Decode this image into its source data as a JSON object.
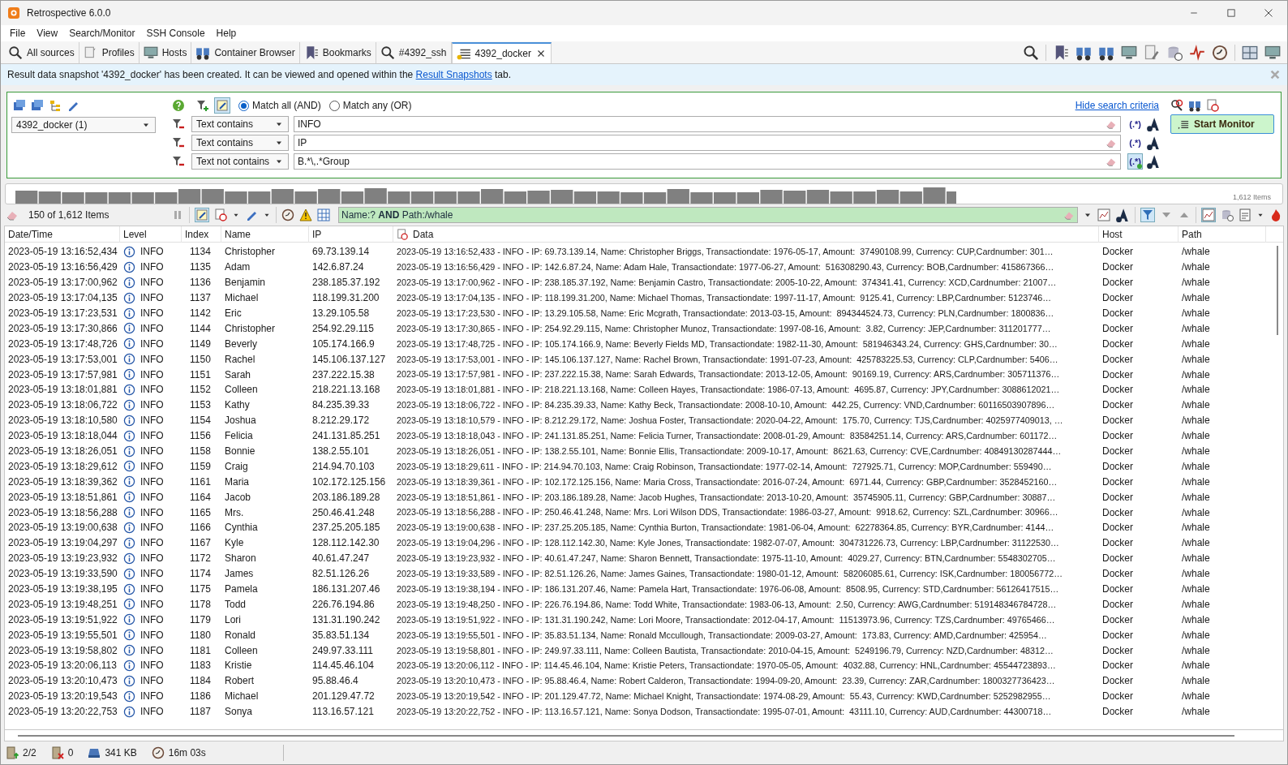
{
  "window": {
    "title": "Retrospective 6.0.0"
  },
  "menu": [
    "File",
    "View",
    "Search/Monitor",
    "SSH Console",
    "Help"
  ],
  "tabs": [
    {
      "label": "All sources",
      "selected": false,
      "closable": false
    },
    {
      "label": "Profiles",
      "selected": false,
      "closable": false
    },
    {
      "label": "Hosts",
      "selected": false,
      "closable": false
    },
    {
      "label": "Container Browser",
      "selected": false,
      "closable": false
    },
    {
      "label": "Bookmarks",
      "selected": false,
      "closable": false
    },
    {
      "label": "#4392_ssh",
      "selected": false,
      "closable": false
    },
    {
      "label": "4392_docker",
      "selected": true,
      "closable": true
    }
  ],
  "notification": {
    "text": "Result data snapshot '4392_docker' has been created. It can be viewed and opened within the",
    "link": "Result Snapshots",
    "text_after": "tab."
  },
  "search": {
    "source": "4392_docker (1)",
    "match_options": [
      {
        "label": "Match all (AND)",
        "selected": true
      },
      {
        "label": "Match any (OR)",
        "selected": false
      }
    ],
    "hide_link": "Hide search criteria",
    "criteria": [
      {
        "operator": "Text contains",
        "value": "INFO",
        "regex_button": "(.*)",
        "regex_active": false
      },
      {
        "operator": "Text contains",
        "value": "IP",
        "regex_button": "(.*)",
        "regex_active": false
      },
      {
        "operator": "Text not contains",
        "value": "B.*\\,.*Group",
        "regex_button": "(.*)",
        "regex_active": true
      }
    ],
    "start_button": "Start Monitor"
  },
  "histogram": {
    "items_label": "1,612 Items"
  },
  "filter_bar": {
    "count": "150 of 1,612 Items",
    "query": "Name:? **AND** Path:/whale"
  },
  "table": {
    "columns": [
      "Date/Time",
      "Level",
      "Index",
      "Name",
      "IP",
      "Data",
      "Host",
      "Path"
    ],
    "rows": [
      [
        "2023-05-19 13:16:52,434",
        "INFO",
        "1134",
        "Christopher",
        "69.73.139.14",
        "2023-05-19 13:16:52,433 - INFO - IP: 69.73.139.14, Name: Christopher Briggs, Transactiondate: 1976-05-17, Amount:  37490108.99, Currency: CUP,Cardnumber: 301…",
        "Docker",
        "/whale"
      ],
      [
        "2023-05-19 13:16:56,429",
        "INFO",
        "1135",
        "Adam",
        "142.6.87.24",
        "2023-05-19 13:16:56,429 - INFO - IP: 142.6.87.24, Name: Adam Hale, Transactiondate: 1977-06-27, Amount:  516308290.43, Currency: BOB,Cardnumber: 415867366…",
        "Docker",
        "/whale"
      ],
      [
        "2023-05-19 13:17:00,962",
        "INFO",
        "1136",
        "Benjamin",
        "238.185.37.192",
        "2023-05-19 13:17:00,962 - INFO - IP: 238.185.37.192, Name: Benjamin Castro, Transactiondate: 2005-10-22, Amount:  374341.41, Currency: XCD,Cardnumber: 21007…",
        "Docker",
        "/whale"
      ],
      [
        "2023-05-19 13:17:04,135",
        "INFO",
        "1137",
        "Michael",
        "118.199.31.200",
        "2023-05-19 13:17:04,135 - INFO - IP: 118.199.31.200, Name: Michael Thomas, Transactiondate: 1997-11-17, Amount:  9125.41, Currency: LBP,Cardnumber: 5123746…",
        "Docker",
        "/whale"
      ],
      [
        "2023-05-19 13:17:23,531",
        "INFO",
        "1142",
        "Eric",
        "13.29.105.58",
        "2023-05-19 13:17:23,530 - INFO - IP: 13.29.105.58, Name: Eric Mcgrath, Transactiondate: 2013-03-15, Amount:  894344524.73, Currency: PLN,Cardnumber: 1800836…",
        "Docker",
        "/whale"
      ],
      [
        "2023-05-19 13:17:30,866",
        "INFO",
        "1144",
        "Christopher",
        "254.92.29.115",
        "2023-05-19 13:17:30,865 - INFO - IP: 254.92.29.115, Name: Christopher Munoz, Transactiondate: 1997-08-16, Amount:  3.82, Currency: JEP,Cardnumber: 311201777…",
        "Docker",
        "/whale"
      ],
      [
        "2023-05-19 13:17:48,726",
        "INFO",
        "1149",
        "Beverly",
        "105.174.166.9",
        "2023-05-19 13:17:48,725 - INFO - IP: 105.174.166.9, Name: Beverly Fields MD, Transactiondate: 1982-11-30, Amount:  581946343.24, Currency: GHS,Cardnumber: 30…",
        "Docker",
        "/whale"
      ],
      [
        "2023-05-19 13:17:53,001",
        "INFO",
        "1150",
        "Rachel",
        "145.106.137.127",
        "2023-05-19 13:17:53,001 - INFO - IP: 145.106.137.127, Name: Rachel Brown, Transactiondate: 1991-07-23, Amount:  425783225.53, Currency: CLP,Cardnumber: 5406…",
        "Docker",
        "/whale"
      ],
      [
        "2023-05-19 13:17:57,981",
        "INFO",
        "1151",
        "Sarah",
        "237.222.15.38",
        "2023-05-19 13:17:57,981 - INFO - IP: 237.222.15.38, Name: Sarah Edwards, Transactiondate: 2013-12-05, Amount:  90169.19, Currency: ARS,Cardnumber: 305711376…",
        "Docker",
        "/whale"
      ],
      [
        "2023-05-19 13:18:01,881",
        "INFO",
        "1152",
        "Colleen",
        "218.221.13.168",
        "2023-05-19 13:18:01,881 - INFO - IP: 218.221.13.168, Name: Colleen Hayes, Transactiondate: 1986-07-13, Amount:  4695.87, Currency: JPY,Cardnumber: 3088612021…",
        "Docker",
        "/whale"
      ],
      [
        "2023-05-19 13:18:06,722",
        "INFO",
        "1153",
        "Kathy",
        "84.235.39.33",
        "2023-05-19 13:18:06,722 - INFO - IP: 84.235.39.33, Name: Kathy Beck, Transactiondate: 2008-10-10, Amount:  442.25, Currency: VND,Cardnumber: 60116503907896…",
        "Docker",
        "/whale"
      ],
      [
        "2023-05-19 13:18:10,580",
        "INFO",
        "1154",
        "Joshua",
        "8.212.29.172",
        "2023-05-19 13:18:10,579 - INFO - IP: 8.212.29.172, Name: Joshua Foster, Transactiondate: 2020-04-22, Amount:  175.70, Currency: TJS,Cardnumber: 4025977409013, …",
        "Docker",
        "/whale"
      ],
      [
        "2023-05-19 13:18:18,044",
        "INFO",
        "1156",
        "Felicia",
        "241.131.85.251",
        "2023-05-19 13:18:18,043 - INFO - IP: 241.131.85.251, Name: Felicia Turner, Transactiondate: 2008-01-29, Amount:  83584251.14, Currency: ARS,Cardnumber: 601172…",
        "Docker",
        "/whale"
      ],
      [
        "2023-05-19 13:18:26,051",
        "INFO",
        "1158",
        "Bonnie",
        "138.2.55.101",
        "2023-05-19 13:18:26,051 - INFO - IP: 138.2.55.101, Name: Bonnie Ellis, Transactiondate: 2009-10-17, Amount:  8621.63, Currency: CVE,Cardnumber: 40849130287444…",
        "Docker",
        "/whale"
      ],
      [
        "2023-05-19 13:18:29,612",
        "INFO",
        "1159",
        "Craig",
        "214.94.70.103",
        "2023-05-19 13:18:29,611 - INFO - IP: 214.94.70.103, Name: Craig Robinson, Transactiondate: 1977-02-14, Amount:  727925.71, Currency: MOP,Cardnumber: 559490…",
        "Docker",
        "/whale"
      ],
      [
        "2023-05-19 13:18:39,362",
        "INFO",
        "1161",
        "Maria",
        "102.172.125.156",
        "2023-05-19 13:18:39,361 - INFO - IP: 102.172.125.156, Name: Maria Cross, Transactiondate: 2016-07-24, Amount:  6971.44, Currency: GBP,Cardnumber: 3528452160…",
        "Docker",
        "/whale"
      ],
      [
        "2023-05-19 13:18:51,861",
        "INFO",
        "1164",
        "Jacob",
        "203.186.189.28",
        "2023-05-19 13:18:51,861 - INFO - IP: 203.186.189.28, Name: Jacob Hughes, Transactiondate: 2013-10-20, Amount:  35745905.11, Currency: GBP,Cardnumber: 30887…",
        "Docker",
        "/whale"
      ],
      [
        "2023-05-19 13:18:56,288",
        "INFO",
        "1165",
        "Mrs.",
        "250.46.41.248",
        "2023-05-19 13:18:56,288 - INFO - IP: 250.46.41.248, Name: Mrs. Lori Wilson DDS, Transactiondate: 1986-03-27, Amount:  9918.62, Currency: SZL,Cardnumber: 30966…",
        "Docker",
        "/whale"
      ],
      [
        "2023-05-19 13:19:00,638",
        "INFO",
        "1166",
        "Cynthia",
        "237.25.205.185",
        "2023-05-19 13:19:00,638 - INFO - IP: 237.25.205.185, Name: Cynthia Burton, Transactiondate: 1981-06-04, Amount:  62278364.85, Currency: BYR,Cardnumber: 4144…",
        "Docker",
        "/whale"
      ],
      [
        "2023-05-19 13:19:04,297",
        "INFO",
        "1167",
        "Kyle",
        "128.112.142.30",
        "2023-05-19 13:19:04,296 - INFO - IP: 128.112.142.30, Name: Kyle Jones, Transactiondate: 1982-07-07, Amount:  304731226.73, Currency: LBP,Cardnumber: 31122530…",
        "Docker",
        "/whale"
      ],
      [
        "2023-05-19 13:19:23,932",
        "INFO",
        "1172",
        "Sharon",
        "40.61.47.247",
        "2023-05-19 13:19:23,932 - INFO - IP: 40.61.47.247, Name: Sharon Bennett, Transactiondate: 1975-11-10, Amount:  4029.27, Currency: BTN,Cardnumber: 5548302705…",
        "Docker",
        "/whale"
      ],
      [
        "2023-05-19 13:19:33,590",
        "INFO",
        "1174",
        "James",
        "82.51.126.26",
        "2023-05-19 13:19:33,589 - INFO - IP: 82.51.126.26, Name: James Gaines, Transactiondate: 1980-01-12, Amount:  58206085.61, Currency: ISK,Cardnumber: 180056772…",
        "Docker",
        "/whale"
      ],
      [
        "2023-05-19 13:19:38,195",
        "INFO",
        "1175",
        "Pamela",
        "186.131.207.46",
        "2023-05-19 13:19:38,194 - INFO - IP: 186.131.207.46, Name: Pamela Hart, Transactiondate: 1976-06-08, Amount:  8508.95, Currency: STD,Cardnumber: 56126417515…",
        "Docker",
        "/whale"
      ],
      [
        "2023-05-19 13:19:48,251",
        "INFO",
        "1178",
        "Todd",
        "226.76.194.86",
        "2023-05-19 13:19:48,250 - INFO - IP: 226.76.194.86, Name: Todd White, Transactiondate: 1983-06-13, Amount:  2.50, Currency: AWG,Cardnumber: 519148346784728…",
        "Docker",
        "/whale"
      ],
      [
        "2023-05-19 13:19:51,922",
        "INFO",
        "1179",
        "Lori",
        "131.31.190.242",
        "2023-05-19 13:19:51,922 - INFO - IP: 131.31.190.242, Name: Lori Moore, Transactiondate: 2012-04-17, Amount:  11513973.96, Currency: TZS,Cardnumber: 49765466…",
        "Docker",
        "/whale"
      ],
      [
        "2023-05-19 13:19:55,501",
        "INFO",
        "1180",
        "Ronald",
        "35.83.51.134",
        "2023-05-19 13:19:55,501 - INFO - IP: 35.83.51.134, Name: Ronald Mccullough, Transactiondate: 2009-03-27, Amount:  173.83, Currency: AMD,Cardnumber: 425954…",
        "Docker",
        "/whale"
      ],
      [
        "2023-05-19 13:19:58,802",
        "INFO",
        "1181",
        "Colleen",
        "249.97.33.111",
        "2023-05-19 13:19:58,801 - INFO - IP: 249.97.33.111, Name: Colleen Bautista, Transactiondate: 2010-04-15, Amount:  5249196.79, Currency: NZD,Cardnumber: 48312…",
        "Docker",
        "/whale"
      ],
      [
        "2023-05-19 13:20:06,113",
        "INFO",
        "1183",
        "Kristie",
        "114.45.46.104",
        "2023-05-19 13:20:06,112 - INFO - IP: 114.45.46.104, Name: Kristie Peters, Transactiondate: 1970-05-05, Amount:  4032.88, Currency: HNL,Cardnumber: 45544723893…",
        "Docker",
        "/whale"
      ],
      [
        "2023-05-19 13:20:10,473",
        "INFO",
        "1184",
        "Robert",
        "95.88.46.4",
        "2023-05-19 13:20:10,473 - INFO - IP: 95.88.46.4, Name: Robert Calderon, Transactiondate: 1994-09-20, Amount:  23.39, Currency: ZAR,Cardnumber: 1800327736423…",
        "Docker",
        "/whale"
      ],
      [
        "2023-05-19 13:20:19,543",
        "INFO",
        "1186",
        "Michael",
        "201.129.47.72",
        "2023-05-19 13:20:19,542 - INFO - IP: 201.129.47.72, Name: Michael Knight, Transactiondate: 1974-08-29, Amount:  55.43, Currency: KWD,Cardnumber: 5252982955…",
        "Docker",
        "/whale"
      ],
      [
        "2023-05-19 13:20:22,753",
        "INFO",
        "1187",
        "Sonya",
        "113.16.57.121",
        "2023-05-19 13:20:22,752 - INFO - IP: 113.16.57.121, Name: Sonya Dodson, Transactiondate: 1995-07-01, Amount:  43111.10, Currency: AUD,Cardnumber: 44300718…",
        "Docker",
        "/whale"
      ]
    ]
  },
  "status_bar": {
    "loaded": "2/2",
    "errors": "0",
    "size": "341 KB",
    "elapsed": "16m 03s"
  }
}
